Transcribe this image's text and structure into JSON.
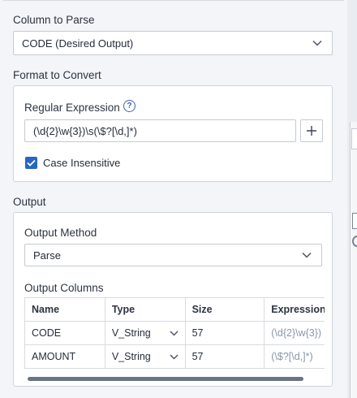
{
  "column_to_parse": {
    "label": "Column to Parse",
    "selected": "CODE (Desired Output)"
  },
  "format_to_convert": {
    "label": "Format to Convert",
    "regex_label": "Regular Expression",
    "help_symbol": "?",
    "regex_value": "(\\d{2}\\w{3})\\s(\\$?[\\d,]*)",
    "case_insensitive_label": "Case Insensitive",
    "case_insensitive_checked": true
  },
  "output": {
    "label": "Output",
    "method_label": "Output Method",
    "method_selected": "Parse",
    "columns_label": "Output Columns",
    "columns": {
      "headers": [
        "Name",
        "Type",
        "Size",
        "Expression"
      ],
      "rows": [
        {
          "name": "CODE",
          "type": "V_String",
          "size": "57",
          "expression": "(\\d{2}\\w{3})"
        },
        {
          "name": "AMOUNT",
          "type": "V_String",
          "size": "57",
          "expression": "(\\$?[\\d,]*)"
        }
      ]
    }
  },
  "colors": {
    "accent": "#2866c4",
    "panel_bg": "#f3f5f8",
    "border": "#c5cad2",
    "expression_text": "#8a96ac"
  },
  "icons": {
    "select_chevron": "chevron-down-icon",
    "help": "help-circle-icon",
    "add": "plus-icon",
    "check": "checkmark-icon"
  }
}
